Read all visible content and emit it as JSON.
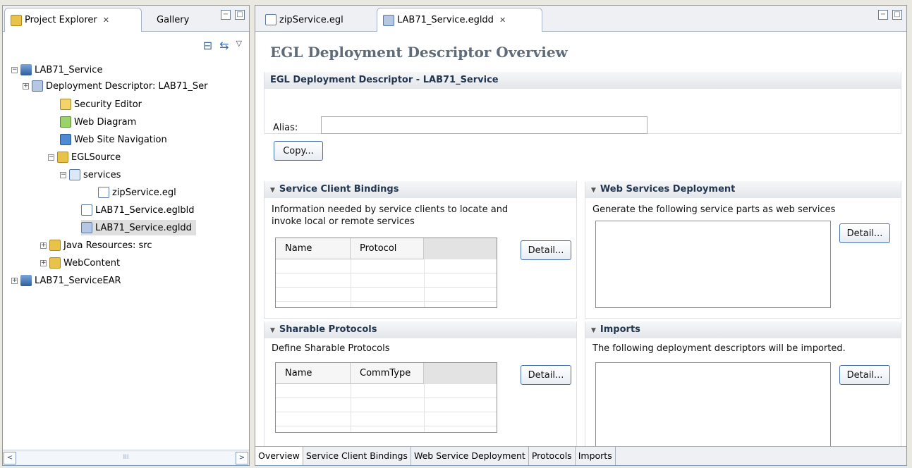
{
  "left_panel": {
    "tabs": [
      {
        "label": "Project Explorer",
        "close": "✕",
        "active": true
      },
      {
        "label": "Gallery",
        "active": false
      }
    ],
    "toolbar_icons": [
      "collapse-all-icon",
      "link-with-editor-icon",
      "view-menu-icon"
    ],
    "tree": [
      {
        "label": "LAB71_Service",
        "icon": "project-icon",
        "expander": "−"
      },
      {
        "label": "Deployment Descriptor: LAB71_Ser",
        "icon": "deployment-descriptor-icon",
        "expander": "+"
      },
      {
        "label": "Security Editor",
        "icon": "security-icon"
      },
      {
        "label": "Web Diagram",
        "icon": "web-diagram-icon"
      },
      {
        "label": "Web Site Navigation",
        "icon": "site-navigation-icon"
      },
      {
        "label": "EGLSource",
        "icon": "folder-icon",
        "expander": "−"
      },
      {
        "label": "services",
        "icon": "package-icon",
        "expander": "−"
      },
      {
        "label": "zipService.egl",
        "icon": "egl-file-icon"
      },
      {
        "label": "LAB71_Service.eglbld",
        "icon": "build-file-icon"
      },
      {
        "label": "LAB71_Service.egldd",
        "icon": "egldd-file-icon"
      },
      {
        "label": "Java Resources: src",
        "icon": "java-resources-icon",
        "expander": "+"
      },
      {
        "label": "WebContent",
        "icon": "folder-icon",
        "expander": "+"
      },
      {
        "label": "LAB71_ServiceEAR",
        "icon": "ear-project-icon",
        "expander": "+"
      }
    ],
    "scroll": {
      "left": "<",
      "right": ">",
      "thumb": "III"
    }
  },
  "right_panel": {
    "tabs": [
      {
        "label": "zipService.egl",
        "active": false
      },
      {
        "label": "LAB71_Service.egldd",
        "close": "✕",
        "active": true
      }
    ],
    "window_buttons": {
      "minimize": "−",
      "maximize": "□"
    },
    "page_title": "EGL Deployment Descriptor Overview",
    "main_section": {
      "title": "EGL Deployment Descriptor - LAB71_Service",
      "alias_label": "Alias:",
      "alias_value": "",
      "copy_button": "Copy..."
    },
    "service_client_bindings": {
      "title": "Service Client Bindings",
      "description": "Information needed by service clients to locate and invoke local or remote services",
      "columns": [
        "Name",
        "Protocol",
        ""
      ],
      "detail_button": "Detail..."
    },
    "web_services_deployment": {
      "title": "Web Services Deployment",
      "description": "Generate the following service parts as web services",
      "detail_button": "Detail..."
    },
    "sharable_protocols": {
      "title": "Sharable Protocols",
      "description": "Define Sharable Protocols",
      "columns": [
        "Name",
        "CommType",
        ""
      ],
      "detail_button": "Detail..."
    },
    "imports": {
      "title": "Imports",
      "description": "The following deployment descriptors will be imported.",
      "detail_button": "Detail..."
    },
    "bottom_tabs": [
      "Overview",
      "Service Client Bindings",
      "Web Service Deployment",
      "Protocols",
      "Imports"
    ]
  }
}
